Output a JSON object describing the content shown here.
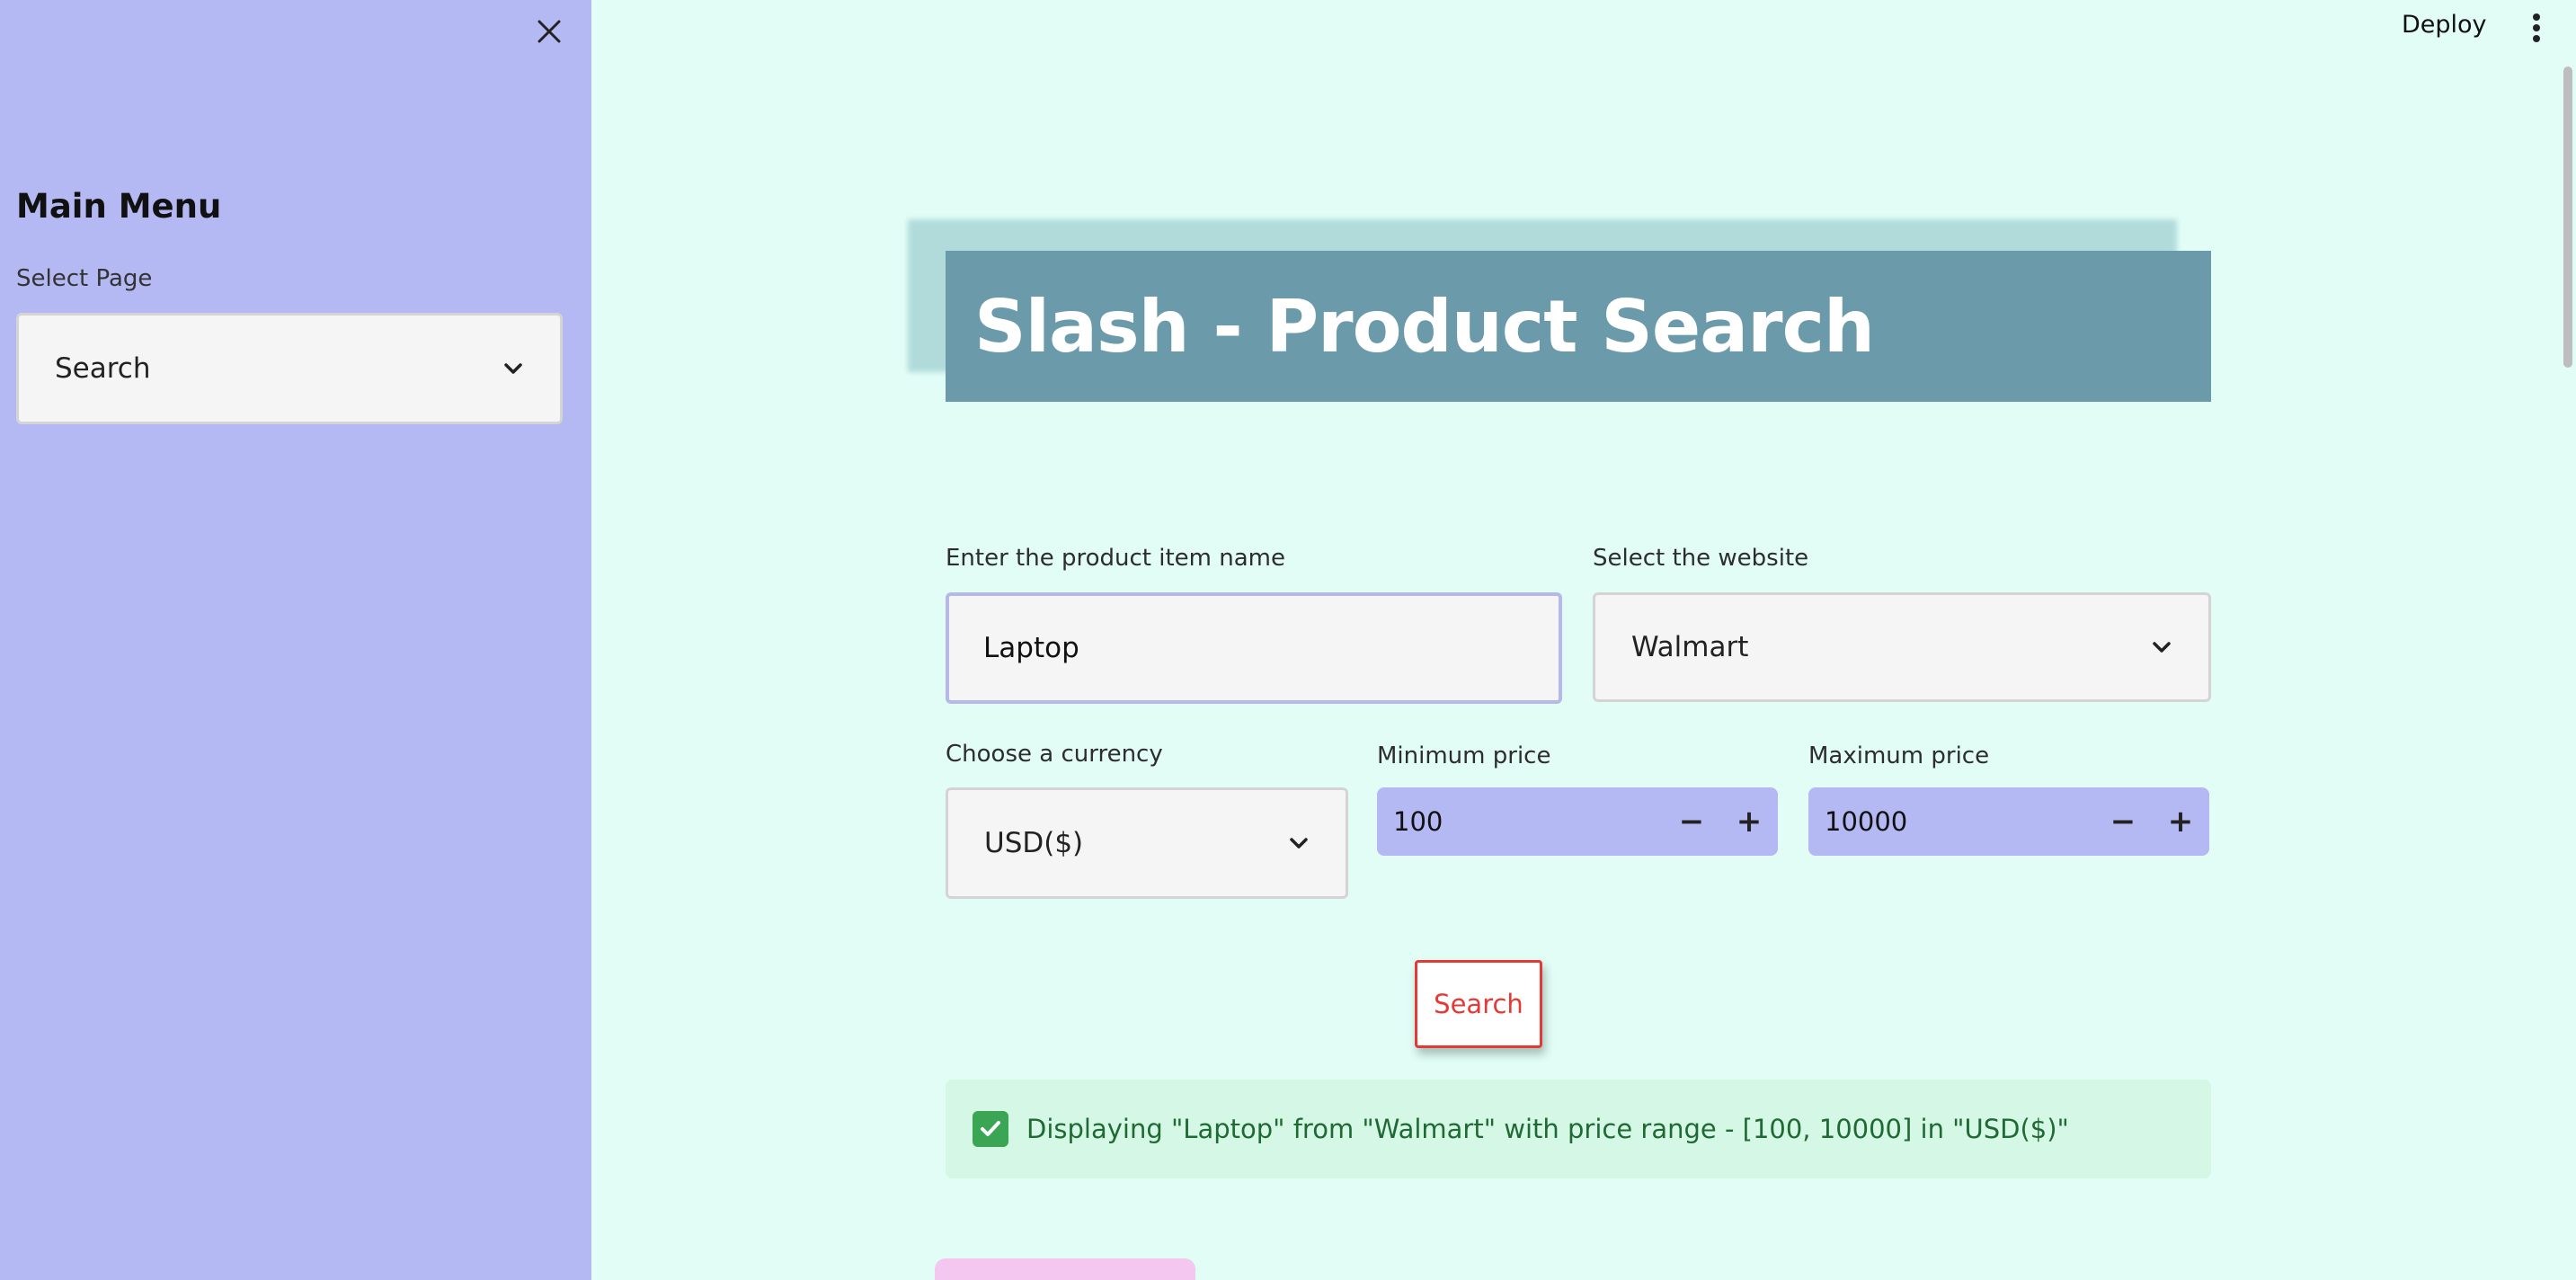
{
  "sidebar": {
    "title": "Main Menu",
    "select_label": "Select Page",
    "select_value": "Search"
  },
  "topbar": {
    "deploy_label": "Deploy"
  },
  "header": {
    "title": "Slash - Product Search"
  },
  "form": {
    "product_label": "Enter the product item name",
    "product_value": "Laptop",
    "website_label": "Select the website",
    "website_value": "Walmart",
    "currency_label": "Choose a currency",
    "currency_value": "USD($)",
    "min_label": "Minimum price",
    "min_value": "100",
    "max_label": "Maximum price",
    "max_value": "10000",
    "minus": "−",
    "plus": "+",
    "search_label": "Search"
  },
  "alert": {
    "text": "Displaying \"Laptop\" from \"Walmart\" with price range - [100, 10000] in \"USD($)\""
  },
  "colors": {
    "sidebar_bg": "#b4b8f3",
    "main_bg": "#e1fdf6",
    "banner_bg": "#6b9aab",
    "search_accent": "#e53935",
    "success_bg": "#d5f7e6",
    "success_text": "#1f6a33"
  },
  "icons": {
    "close": "close-icon",
    "dropdown": "chevron-down-icon",
    "menu": "kebab-menu-icon",
    "success": "check-mark-icon"
  }
}
